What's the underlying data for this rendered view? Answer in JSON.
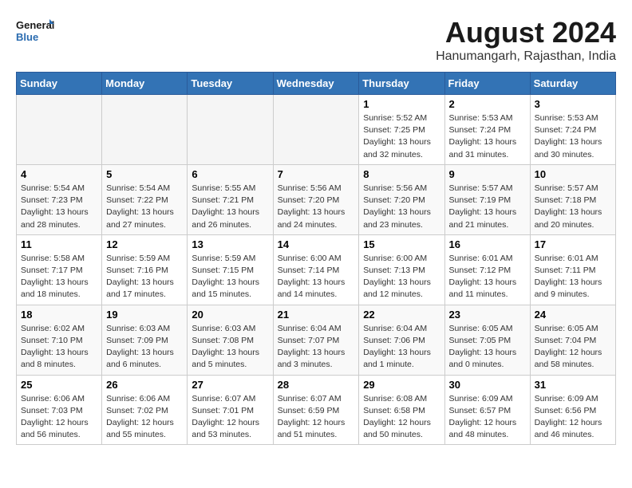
{
  "header": {
    "logo_general": "General",
    "logo_blue": "Blue",
    "month_year": "August 2024",
    "location": "Hanumangarh, Rajasthan, India"
  },
  "weekdays": [
    "Sunday",
    "Monday",
    "Tuesday",
    "Wednesday",
    "Thursday",
    "Friday",
    "Saturday"
  ],
  "weeks": [
    [
      {
        "day": "",
        "empty": true
      },
      {
        "day": "",
        "empty": true
      },
      {
        "day": "",
        "empty": true
      },
      {
        "day": "",
        "empty": true
      },
      {
        "day": "1",
        "empty": false,
        "info": "Sunrise: 5:52 AM\nSunset: 7:25 PM\nDaylight: 13 hours\nand 32 minutes."
      },
      {
        "day": "2",
        "empty": false,
        "info": "Sunrise: 5:53 AM\nSunset: 7:24 PM\nDaylight: 13 hours\nand 31 minutes."
      },
      {
        "day": "3",
        "empty": false,
        "info": "Sunrise: 5:53 AM\nSunset: 7:24 PM\nDaylight: 13 hours\nand 30 minutes."
      }
    ],
    [
      {
        "day": "4",
        "empty": false,
        "info": "Sunrise: 5:54 AM\nSunset: 7:23 PM\nDaylight: 13 hours\nand 28 minutes."
      },
      {
        "day": "5",
        "empty": false,
        "info": "Sunrise: 5:54 AM\nSunset: 7:22 PM\nDaylight: 13 hours\nand 27 minutes."
      },
      {
        "day": "6",
        "empty": false,
        "info": "Sunrise: 5:55 AM\nSunset: 7:21 PM\nDaylight: 13 hours\nand 26 minutes."
      },
      {
        "day": "7",
        "empty": false,
        "info": "Sunrise: 5:56 AM\nSunset: 7:20 PM\nDaylight: 13 hours\nand 24 minutes."
      },
      {
        "day": "8",
        "empty": false,
        "info": "Sunrise: 5:56 AM\nSunset: 7:20 PM\nDaylight: 13 hours\nand 23 minutes."
      },
      {
        "day": "9",
        "empty": false,
        "info": "Sunrise: 5:57 AM\nSunset: 7:19 PM\nDaylight: 13 hours\nand 21 minutes."
      },
      {
        "day": "10",
        "empty": false,
        "info": "Sunrise: 5:57 AM\nSunset: 7:18 PM\nDaylight: 13 hours\nand 20 minutes."
      }
    ],
    [
      {
        "day": "11",
        "empty": false,
        "info": "Sunrise: 5:58 AM\nSunset: 7:17 PM\nDaylight: 13 hours\nand 18 minutes."
      },
      {
        "day": "12",
        "empty": false,
        "info": "Sunrise: 5:59 AM\nSunset: 7:16 PM\nDaylight: 13 hours\nand 17 minutes."
      },
      {
        "day": "13",
        "empty": false,
        "info": "Sunrise: 5:59 AM\nSunset: 7:15 PM\nDaylight: 13 hours\nand 15 minutes."
      },
      {
        "day": "14",
        "empty": false,
        "info": "Sunrise: 6:00 AM\nSunset: 7:14 PM\nDaylight: 13 hours\nand 14 minutes."
      },
      {
        "day": "15",
        "empty": false,
        "info": "Sunrise: 6:00 AM\nSunset: 7:13 PM\nDaylight: 13 hours\nand 12 minutes."
      },
      {
        "day": "16",
        "empty": false,
        "info": "Sunrise: 6:01 AM\nSunset: 7:12 PM\nDaylight: 13 hours\nand 11 minutes."
      },
      {
        "day": "17",
        "empty": false,
        "info": "Sunrise: 6:01 AM\nSunset: 7:11 PM\nDaylight: 13 hours\nand 9 minutes."
      }
    ],
    [
      {
        "day": "18",
        "empty": false,
        "info": "Sunrise: 6:02 AM\nSunset: 7:10 PM\nDaylight: 13 hours\nand 8 minutes."
      },
      {
        "day": "19",
        "empty": false,
        "info": "Sunrise: 6:03 AM\nSunset: 7:09 PM\nDaylight: 13 hours\nand 6 minutes."
      },
      {
        "day": "20",
        "empty": false,
        "info": "Sunrise: 6:03 AM\nSunset: 7:08 PM\nDaylight: 13 hours\nand 5 minutes."
      },
      {
        "day": "21",
        "empty": false,
        "info": "Sunrise: 6:04 AM\nSunset: 7:07 PM\nDaylight: 13 hours\nand 3 minutes."
      },
      {
        "day": "22",
        "empty": false,
        "info": "Sunrise: 6:04 AM\nSunset: 7:06 PM\nDaylight: 13 hours\nand 1 minute."
      },
      {
        "day": "23",
        "empty": false,
        "info": "Sunrise: 6:05 AM\nSunset: 7:05 PM\nDaylight: 13 hours\nand 0 minutes."
      },
      {
        "day": "24",
        "empty": false,
        "info": "Sunrise: 6:05 AM\nSunset: 7:04 PM\nDaylight: 12 hours\nand 58 minutes."
      }
    ],
    [
      {
        "day": "25",
        "empty": false,
        "info": "Sunrise: 6:06 AM\nSunset: 7:03 PM\nDaylight: 12 hours\nand 56 minutes."
      },
      {
        "day": "26",
        "empty": false,
        "info": "Sunrise: 6:06 AM\nSunset: 7:02 PM\nDaylight: 12 hours\nand 55 minutes."
      },
      {
        "day": "27",
        "empty": false,
        "info": "Sunrise: 6:07 AM\nSunset: 7:01 PM\nDaylight: 12 hours\nand 53 minutes."
      },
      {
        "day": "28",
        "empty": false,
        "info": "Sunrise: 6:07 AM\nSunset: 6:59 PM\nDaylight: 12 hours\nand 51 minutes."
      },
      {
        "day": "29",
        "empty": false,
        "info": "Sunrise: 6:08 AM\nSunset: 6:58 PM\nDaylight: 12 hours\nand 50 minutes."
      },
      {
        "day": "30",
        "empty": false,
        "info": "Sunrise: 6:09 AM\nSunset: 6:57 PM\nDaylight: 12 hours\nand 48 minutes."
      },
      {
        "day": "31",
        "empty": false,
        "info": "Sunrise: 6:09 AM\nSunset: 6:56 PM\nDaylight: 12 hours\nand 46 minutes."
      }
    ]
  ]
}
